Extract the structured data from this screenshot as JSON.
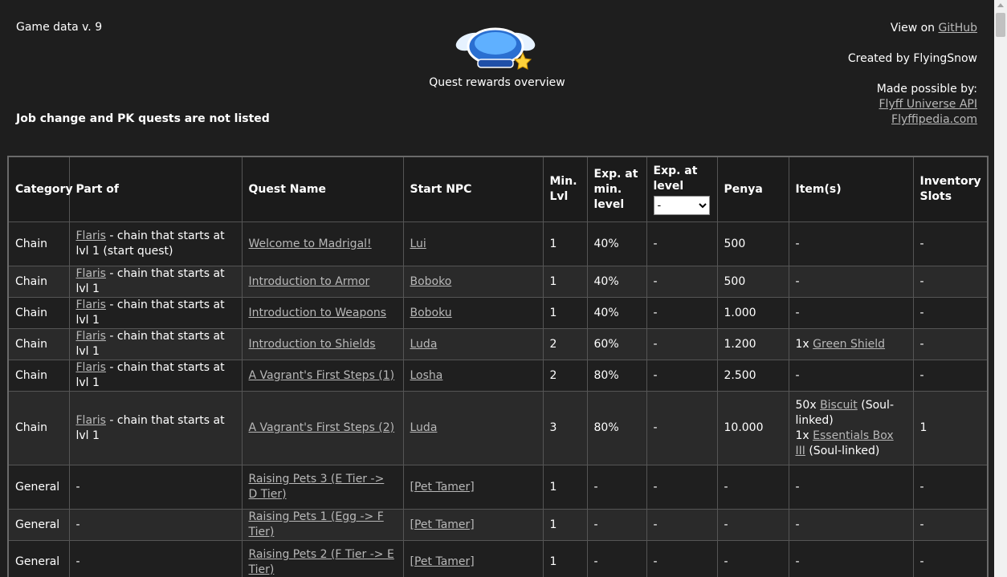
{
  "header": {
    "version_text": "Game data v. 9",
    "note": "Job change and PK quests are not listed",
    "title": "Quest rewards overview",
    "view_on_prefix": "View on ",
    "github_link": "GitHub",
    "created_by": "Created by FlyingSnow",
    "made_possible": "Made possible by:",
    "credits": [
      "Flyff Universe API",
      "Flyffipedia.com"
    ]
  },
  "table": {
    "columns": [
      "Category",
      "Part of",
      "Quest Name",
      "Start NPC",
      "Min. Lvl",
      "Exp. at min. level",
      "Exp. at level",
      "Penya",
      "Item(s)",
      "Inventory Slots"
    ],
    "level_select": {
      "selected": "-"
    },
    "rows": [
      {
        "category": "Chain",
        "part_of_link": "Flaris",
        "part_of_text": " - chain that starts at lvl 1 (start quest)",
        "quest": "Welcome to Madrigal!",
        "npc": "Lui",
        "min_lvl": "1",
        "exp_min": "40%",
        "exp_at": "-",
        "penya": "500",
        "items_text": "-",
        "slots": "-"
      },
      {
        "category": "Chain",
        "part_of_link": "Flaris",
        "part_of_text": " - chain that starts at lvl 1",
        "quest": "Introduction to Armor",
        "npc": "Boboko",
        "min_lvl": "1",
        "exp_min": "40%",
        "exp_at": "-",
        "penya": "500",
        "items_text": "-",
        "slots": "-"
      },
      {
        "category": "Chain",
        "part_of_link": "Flaris",
        "part_of_text": " - chain that starts at lvl 1",
        "quest": "Introduction to Weapons",
        "npc": "Boboku",
        "min_lvl": "1",
        "exp_min": "40%",
        "exp_at": "-",
        "penya": "1.000",
        "items_text": "-",
        "slots": "-"
      },
      {
        "category": "Chain",
        "part_of_link": "Flaris",
        "part_of_text": " - chain that starts at lvl 1",
        "quest": "Introduction to Shields",
        "npc": "Luda",
        "min_lvl": "2",
        "exp_min": "60%",
        "exp_at": "-",
        "penya": "1.200",
        "items": [
          {
            "qty": "1x ",
            "name": "Green Shield",
            "suffix": ""
          }
        ],
        "slots": "-"
      },
      {
        "category": "Chain",
        "part_of_link": "Flaris",
        "part_of_text": " - chain that starts at lvl 1",
        "quest": "A Vagrant's First Steps (1)",
        "npc": "Losha",
        "min_lvl": "2",
        "exp_min": "80%",
        "exp_at": "-",
        "penya": "2.500",
        "items_text": "-",
        "slots": "-"
      },
      {
        "category": "Chain",
        "part_of_link": "Flaris",
        "part_of_text": " - chain that starts at lvl 1",
        "quest": "A Vagrant's First Steps (2)",
        "npc": "Luda",
        "min_lvl": "3",
        "exp_min": "80%",
        "exp_at": "-",
        "penya": "10.000",
        "items": [
          {
            "qty": "50x ",
            "name": "Biscuit",
            "suffix": " (Soul-linked)"
          },
          {
            "qty": "1x ",
            "name": "Essentials Box III",
            "suffix": " (Soul-linked)"
          }
        ],
        "slots": "1"
      },
      {
        "category": "General",
        "part_of_text": "-",
        "quest": "Raising Pets 3 (E Tier -> D Tier)",
        "npc": "[Pet Tamer]",
        "min_lvl": "1",
        "exp_min": "-",
        "exp_at": "-",
        "penya": "-",
        "items_text": "-",
        "slots": "-"
      },
      {
        "category": "General",
        "part_of_text": "-",
        "quest": "Raising Pets 1 (Egg -> F Tier)",
        "npc": "[Pet Tamer]",
        "min_lvl": "1",
        "exp_min": "-",
        "exp_at": "-",
        "penya": "-",
        "items_text": "-",
        "slots": "-"
      },
      {
        "category": "General",
        "part_of_text": "-",
        "quest": "Raising Pets 2 (F Tier -> E Tier)",
        "npc": "[Pet Tamer]",
        "min_lvl": "1",
        "exp_min": "-",
        "exp_at": "-",
        "penya": "-",
        "items_text": "-",
        "slots": "-"
      }
    ]
  }
}
